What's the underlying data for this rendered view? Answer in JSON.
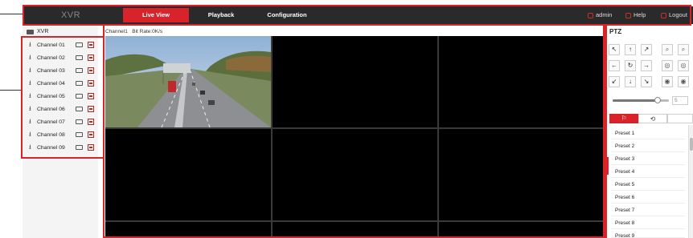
{
  "header": {
    "brand": "XVR",
    "tabs": [
      {
        "label": "Live View",
        "active": true
      },
      {
        "label": "Playback",
        "active": false
      },
      {
        "label": "Configuration",
        "active": false
      }
    ],
    "user": "admin",
    "help": "Help",
    "logout": "Logout"
  },
  "left": {
    "root": "XVR",
    "channels": [
      "Channel 01",
      "Channel 02",
      "Channel 03",
      "Channel 04",
      "Channel 05",
      "Channel 06",
      "Channel 07",
      "Channel 08",
      "Channel 09"
    ]
  },
  "center": {
    "channel": "Channel1",
    "bitrate": "Bit Rate:0K/s"
  },
  "ptz": {
    "title": "PTZ",
    "arrows": {
      "up_left": "↖",
      "up": "↑",
      "up_right": "↗",
      "left": "←",
      "auto": "↻",
      "right": "→",
      "down_left": "↙",
      "down": "↓",
      "down_right": "↘"
    },
    "speed_value": "5",
    "speed_level_fraction": 0.8,
    "presets": [
      "Preset 1",
      "Preset 2",
      "Preset 3",
      "Preset 4",
      "Preset 5",
      "Preset 6",
      "Preset 7",
      "Preset 8",
      "Preset 9"
    ]
  },
  "colors": {
    "accent": "#d8232a",
    "topbar": "#2a2a2a"
  }
}
